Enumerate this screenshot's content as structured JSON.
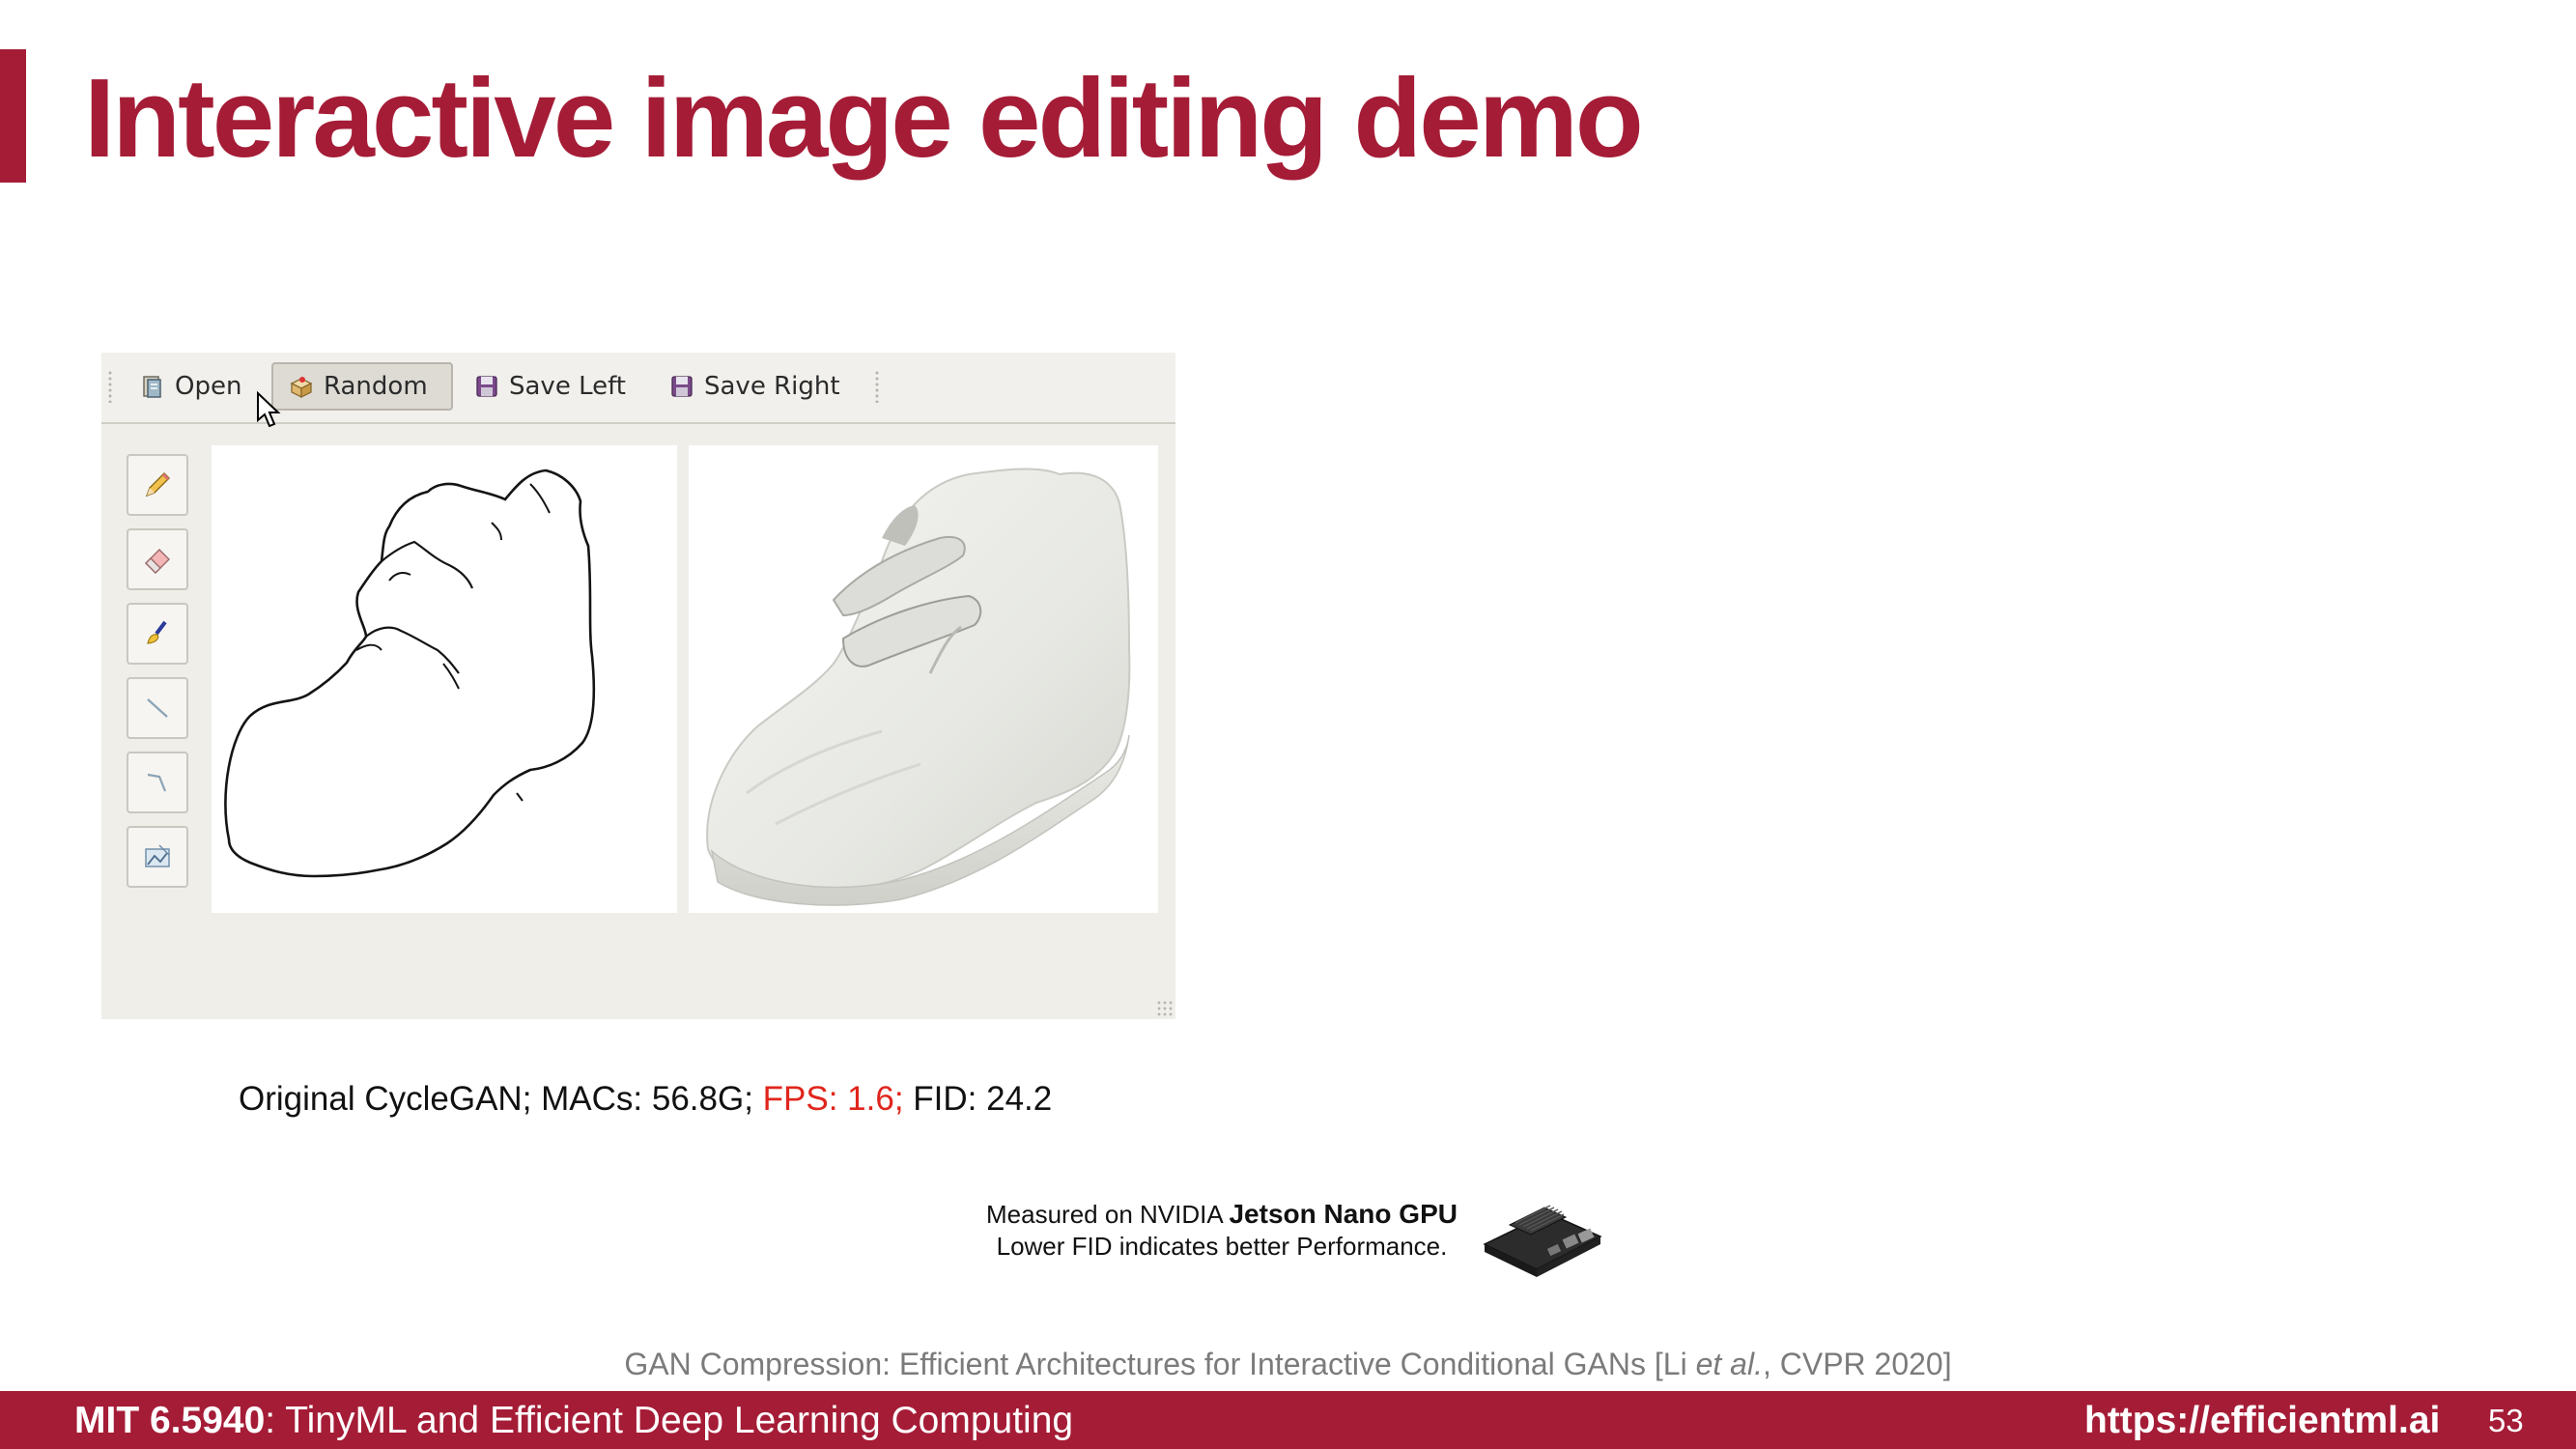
{
  "slide": {
    "title": "Interactive image editing demo",
    "accent_color": "#a51c36"
  },
  "app": {
    "toolbar": [
      {
        "label": "Open",
        "icon": "open-file-icon"
      },
      {
        "label": "Random",
        "icon": "random-box-icon",
        "active": true
      },
      {
        "label": "Save Left",
        "icon": "floppy-disk-icon"
      },
      {
        "label": "Save Right",
        "icon": "floppy-disk-icon"
      }
    ],
    "tools": [
      "pencil-icon",
      "eraser-icon",
      "fill-brush-icon",
      "line-icon",
      "polyline-icon",
      "image-icon"
    ]
  },
  "caption": {
    "prefix": "Original CycleGAN; MACs: 56.8G; ",
    "fps": "FPS: 1.6;",
    "suffix": " FID: 24.2",
    "fps_color": "#e0251c"
  },
  "measurement": {
    "line1_prefix": "Measured on NVIDIA ",
    "line1_bold": "Jetson Nano GPU",
    "line2": "Lower FID indicates better Performance."
  },
  "citation": {
    "prefix": "GAN Compression: Efficient Architectures for Interactive Conditional GANs [Li ",
    "italic": "et al.",
    "suffix": ", CVPR 2020]"
  },
  "footer": {
    "course_code": "MIT 6.5940",
    "course_name": ": TinyML and Efficient Deep Learning Computing",
    "url": "https://efficientml.ai",
    "page": "53"
  }
}
